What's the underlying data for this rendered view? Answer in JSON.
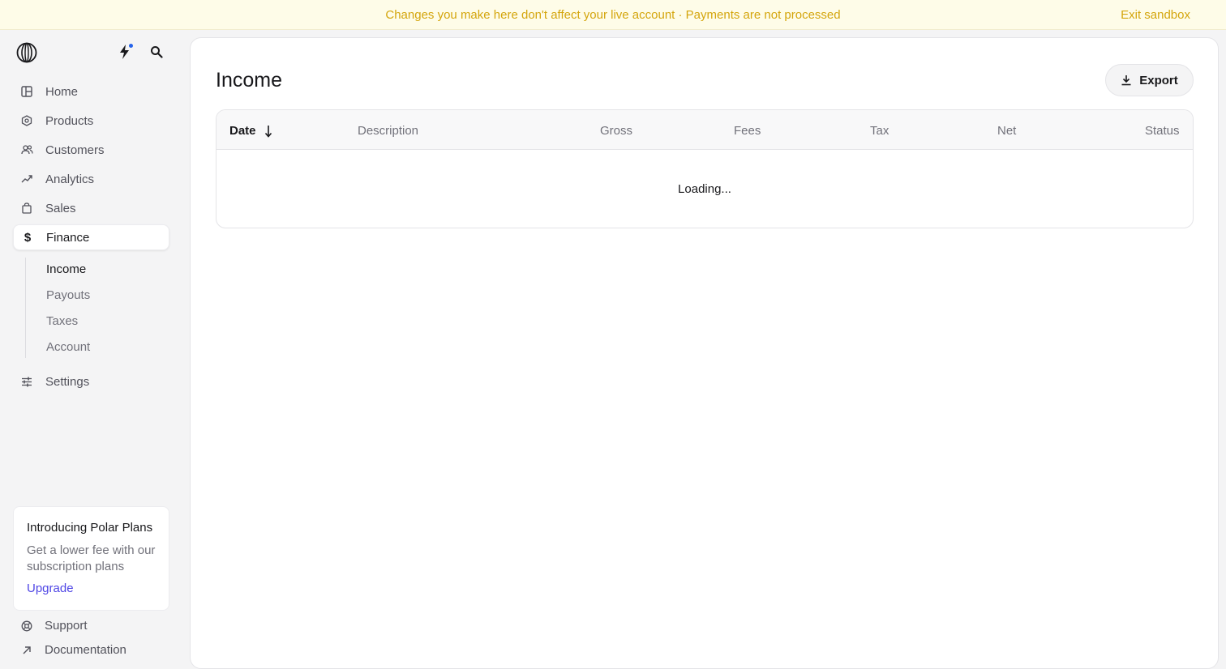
{
  "banner": {
    "message": "Changes you make here don't affect your live account · Payments are not processed",
    "exit_label": "Exit sandbox"
  },
  "sidebar": {
    "nav": [
      {
        "label": "Home",
        "icon": "home-icon"
      },
      {
        "label": "Products",
        "icon": "products-icon"
      },
      {
        "label": "Customers",
        "icon": "customers-icon"
      },
      {
        "label": "Analytics",
        "icon": "analytics-icon"
      },
      {
        "label": "Sales",
        "icon": "sales-icon"
      },
      {
        "label": "Finance",
        "icon": "dollar-icon",
        "active": true
      },
      {
        "label": "Settings",
        "icon": "settings-icon"
      }
    ],
    "subnav": [
      {
        "label": "Income",
        "active": true
      },
      {
        "label": "Payouts"
      },
      {
        "label": "Taxes"
      },
      {
        "label": "Account"
      }
    ],
    "promo": {
      "title": "Introducing Polar Plans",
      "text": "Get a lower fee with our subscription plans",
      "link": "Upgrade"
    },
    "footer": [
      {
        "label": "Support",
        "icon": "support-icon"
      },
      {
        "label": "Documentation",
        "icon": "external-link-icon"
      }
    ]
  },
  "main": {
    "title": "Income",
    "export_label": "Export",
    "table": {
      "columns": [
        "Date",
        "Description",
        "Gross",
        "Fees",
        "Tax",
        "Net",
        "Status"
      ],
      "sorted_column": "Date",
      "sort_direction": "descending",
      "status_text": "Loading..."
    }
  },
  "colors": {
    "banner_bg": "#fefce8",
    "banner_text": "#d4a50c",
    "accent_link": "#4f46e5",
    "notification_dot": "#2563eb"
  }
}
